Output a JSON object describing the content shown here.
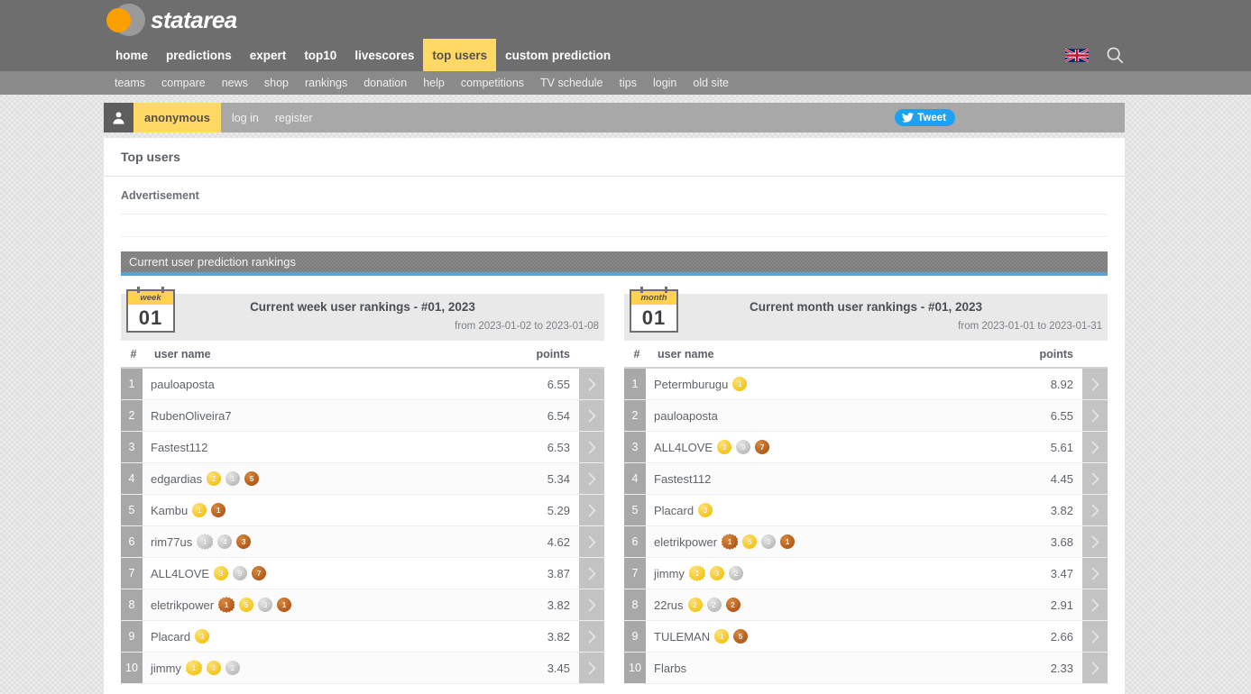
{
  "brand": {
    "name": "statarea"
  },
  "nav_primary": [
    {
      "label": "home",
      "active": false
    },
    {
      "label": "predictions",
      "active": false
    },
    {
      "label": "expert",
      "active": false
    },
    {
      "label": "top10",
      "active": false
    },
    {
      "label": "livescores",
      "active": false
    },
    {
      "label": "top users",
      "active": true
    },
    {
      "label": "custom prediction",
      "active": false
    }
  ],
  "nav_secondary": [
    "teams",
    "compare",
    "news",
    "shop",
    "rankings",
    "donation",
    "help",
    "competitions",
    "TV schedule",
    "tips",
    "login",
    "old site"
  ],
  "header_icons": {
    "flag": "uk-flag-icon",
    "search": "search-icon"
  },
  "userbar": {
    "avatar_icon": "user-avatar-icon",
    "username": "anonymous",
    "links": [
      "log in",
      "register"
    ],
    "tweet_label": "Tweet",
    "tweet_icon": "twitter-bird-icon"
  },
  "page": {
    "title": "Top users",
    "ad_label": "Advertisement",
    "section_header": "Current user prediction rankings"
  },
  "colors": {
    "accent_yellow": "#ffd964",
    "nav_gray": "#6e6e6e",
    "subnav_gray": "#8a8a8a",
    "section_underline": "#5ba3d0",
    "twitter_blue": "#1da1f2",
    "logo_orange": "#f9a000",
    "gold": "#f5c518",
    "silver": "#bdbdbd",
    "bronze": "#b4591a"
  },
  "columns": {
    "rank": "#",
    "name": "user name",
    "points": "points"
  },
  "panels": [
    {
      "cal_label": "week",
      "cal_number": "01",
      "title": "Current week user rankings - #01, 2023",
      "range": "from 2023-01-02 to 2023-01-08",
      "rows": [
        {
          "rank": "1",
          "name": "pauloaposta",
          "points": "6.55",
          "medals": []
        },
        {
          "rank": "2",
          "name": "RubenOliveira7",
          "points": "6.54",
          "medals": []
        },
        {
          "rank": "3",
          "name": "Fastest112",
          "points": "6.53",
          "medals": []
        },
        {
          "rank": "4",
          "name": "edgardias",
          "points": "5.34",
          "medals": [
            {
              "type": "gold",
              "star": false,
              "count": "2"
            },
            {
              "type": "silver",
              "star": false,
              "count": "1"
            },
            {
              "type": "bronze",
              "star": false,
              "count": "5"
            }
          ]
        },
        {
          "rank": "5",
          "name": "Kambu",
          "points": "5.29",
          "medals": [
            {
              "type": "gold",
              "star": false,
              "count": "1"
            },
            {
              "type": "bronze",
              "star": false,
              "count": "1"
            }
          ]
        },
        {
          "rank": "6",
          "name": "rim77us",
          "points": "4.62",
          "medals": [
            {
              "type": "silver",
              "star": true,
              "count": "1"
            },
            {
              "type": "silver",
              "star": false,
              "count": "4"
            },
            {
              "type": "bronze",
              "star": false,
              "count": "3"
            }
          ]
        },
        {
          "rank": "7",
          "name": "ALL4LOVE",
          "points": "3.87",
          "medals": [
            {
              "type": "gold",
              "star": false,
              "count": "3"
            },
            {
              "type": "silver",
              "star": false,
              "count": "9"
            },
            {
              "type": "bronze",
              "star": false,
              "count": "7"
            }
          ]
        },
        {
          "rank": "8",
          "name": "eletrikpower",
          "points": "3.82",
          "medals": [
            {
              "type": "bronze",
              "star": true,
              "count": "1"
            },
            {
              "type": "gold",
              "star": false,
              "count": "5"
            },
            {
              "type": "silver",
              "star": false,
              "count": "3"
            },
            {
              "type": "bronze",
              "star": false,
              "count": "1"
            }
          ]
        },
        {
          "rank": "9",
          "name": "Placard",
          "points": "3.82",
          "medals": [
            {
              "type": "gold",
              "star": false,
              "count": "3"
            }
          ]
        },
        {
          "rank": "10",
          "name": "jimmy",
          "points": "3.45",
          "medals": [
            {
              "type": "gold",
              "star": true,
              "count": "1"
            },
            {
              "type": "gold",
              "star": false,
              "count": "3"
            },
            {
              "type": "silver",
              "star": false,
              "count": "2"
            }
          ]
        }
      ]
    },
    {
      "cal_label": "month",
      "cal_number": "01",
      "title": "Current month user rankings - #01, 2023",
      "range": "from 2023-01-01 to 2023-01-31",
      "rows": [
        {
          "rank": "1",
          "name": "Petermburugu",
          "points": "8.92",
          "medals": [
            {
              "type": "gold",
              "star": false,
              "count": "1"
            }
          ]
        },
        {
          "rank": "2",
          "name": "pauloaposta",
          "points": "6.55",
          "medals": []
        },
        {
          "rank": "3",
          "name": "ALL4LOVE",
          "points": "5.61",
          "medals": [
            {
              "type": "gold",
              "star": false,
              "count": "3"
            },
            {
              "type": "silver",
              "star": false,
              "count": "9"
            },
            {
              "type": "bronze",
              "star": false,
              "count": "7"
            }
          ]
        },
        {
          "rank": "4",
          "name": "Fastest112",
          "points": "4.45",
          "medals": []
        },
        {
          "rank": "5",
          "name": "Placard",
          "points": "3.82",
          "medals": [
            {
              "type": "gold",
              "star": false,
              "count": "3"
            }
          ]
        },
        {
          "rank": "6",
          "name": "eletrikpower",
          "points": "3.68",
          "medals": [
            {
              "type": "bronze",
              "star": true,
              "count": "1"
            },
            {
              "type": "gold",
              "star": false,
              "count": "5"
            },
            {
              "type": "silver",
              "star": false,
              "count": "3"
            },
            {
              "type": "bronze",
              "star": false,
              "count": "1"
            }
          ]
        },
        {
          "rank": "7",
          "name": "jimmy",
          "points": "3.47",
          "medals": [
            {
              "type": "gold",
              "star": true,
              "count": "1"
            },
            {
              "type": "gold",
              "star": false,
              "count": "3"
            },
            {
              "type": "silver",
              "star": false,
              "count": "2"
            }
          ]
        },
        {
          "rank": "8",
          "name": "22rus",
          "points": "2.91",
          "medals": [
            {
              "type": "gold",
              "star": false,
              "count": "2"
            },
            {
              "type": "silver",
              "star": false,
              "count": "2"
            },
            {
              "type": "bronze",
              "star": false,
              "count": "2"
            }
          ]
        },
        {
          "rank": "9",
          "name": "TULEMAN",
          "points": "2.66",
          "medals": [
            {
              "type": "gold",
              "star": false,
              "count": "1"
            },
            {
              "type": "bronze",
              "star": false,
              "count": "5"
            }
          ]
        },
        {
          "rank": "10",
          "name": "Flarbs",
          "points": "2.33",
          "medals": []
        }
      ]
    }
  ]
}
